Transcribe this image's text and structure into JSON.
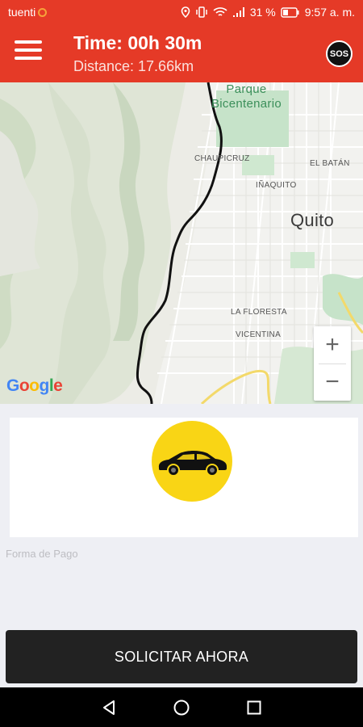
{
  "status_bar": {
    "carrier": "tuenti",
    "battery_percent": "31 %",
    "clock": "9:57 a. m."
  },
  "header": {
    "time_text": "Time: 00h 30m",
    "distance_text": "Distance: 17.66km",
    "sos_label": "SOS"
  },
  "map": {
    "park_name_line1": "Parque",
    "park_name_line2": "Bicentenario",
    "labels": {
      "chaupicruz": "CHAUPICRUZ",
      "el_batan": "EL BATÁN",
      "inaquito": "IÑAQUITO",
      "quito": "Quito",
      "la_floresta": "LA FLORESTA",
      "vicentina": "VICENTINA"
    },
    "zoom_in": "+",
    "zoom_out": "−",
    "attribution": "Google"
  },
  "payment_label": "Forma de Pago",
  "request_button": "SOLICITAR AHORA",
  "colors": {
    "header_red": "#e53a27",
    "car_circle_yellow": "#f9d515",
    "button_dark": "#222222"
  }
}
